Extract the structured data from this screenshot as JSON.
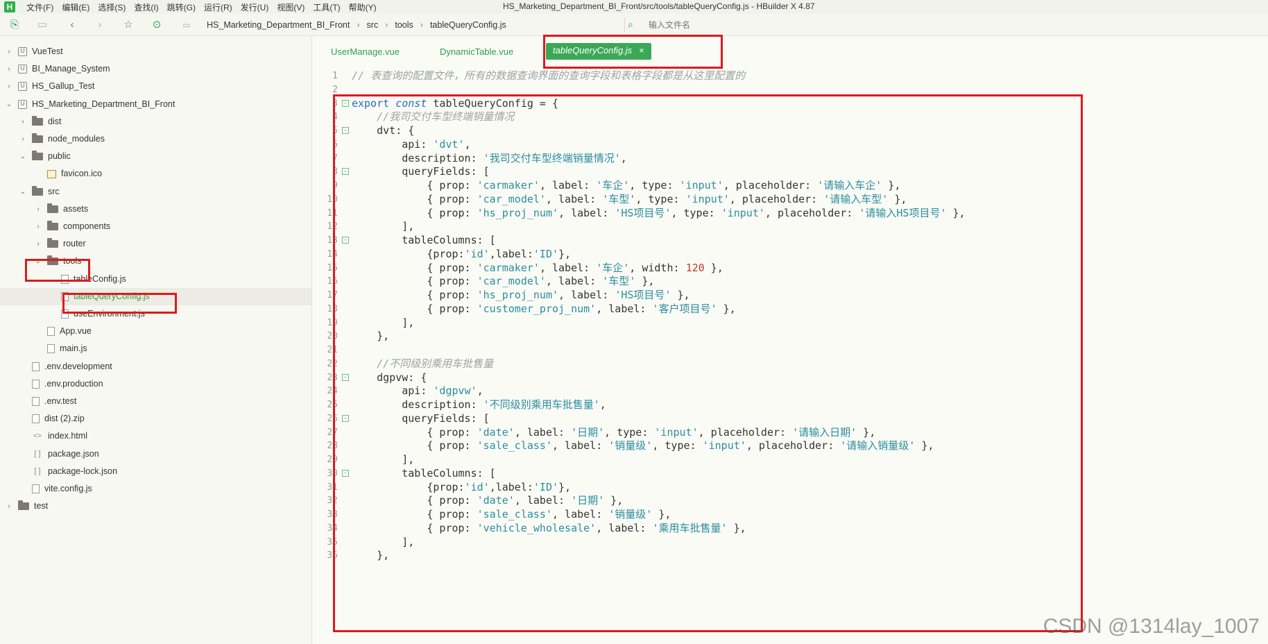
{
  "app": {
    "window_title": "HS_Marketing_Department_BI_Front/src/tools/tableQueryConfig.js - HBuilder X 4.87",
    "logo_letter": "H",
    "menus": [
      "文件(F)",
      "编辑(E)",
      "选择(S)",
      "查找(I)",
      "跳转(G)",
      "运行(R)",
      "发行(U)",
      "视图(V)",
      "工具(T)",
      "帮助(Y)"
    ]
  },
  "toolbar": {
    "breadcrumbs": [
      "HS_Marketing_Department_BI_Front",
      "src",
      "tools",
      "tableQueryConfig.js"
    ],
    "search_placeholder": "输入文件名"
  },
  "sidebar": {
    "items": [
      {
        "label": "VueTest",
        "depth": 0,
        "chev": "›",
        "icon": "project"
      },
      {
        "label": "BI_Manage_System",
        "depth": 0,
        "chev": "›",
        "icon": "project"
      },
      {
        "label": "HS_Gallup_Test",
        "depth": 0,
        "chev": "›",
        "icon": "project"
      },
      {
        "label": "HS_Marketing_Department_BI_Front",
        "depth": 0,
        "chev": "⌄",
        "icon": "project"
      },
      {
        "label": "dist",
        "depth": 1,
        "chev": "›",
        "icon": "folder"
      },
      {
        "label": "node_modules",
        "depth": 1,
        "chev": "›",
        "icon": "folder"
      },
      {
        "label": "public",
        "depth": 1,
        "chev": "⌄",
        "icon": "folder"
      },
      {
        "label": "favicon.ico",
        "depth": 2,
        "chev": "",
        "icon": "fileimg"
      },
      {
        "label": "src",
        "depth": 1,
        "chev": "⌄",
        "icon": "folder"
      },
      {
        "label": "assets",
        "depth": 2,
        "chev": "›",
        "icon": "folder"
      },
      {
        "label": "components",
        "depth": 2,
        "chev": "›",
        "icon": "folder"
      },
      {
        "label": "router",
        "depth": 2,
        "chev": "›",
        "icon": "folder"
      },
      {
        "label": "tools",
        "depth": 2,
        "chev": "⌄",
        "icon": "folder"
      },
      {
        "label": "tableConfig.js",
        "depth": 3,
        "chev": "",
        "icon": "file"
      },
      {
        "label": "tableQueryConfig.js",
        "depth": 3,
        "chev": "",
        "icon": "file",
        "selected": true
      },
      {
        "label": "useEnvironment.js",
        "depth": 3,
        "chev": "",
        "icon": "file"
      },
      {
        "label": "App.vue",
        "depth": 2,
        "chev": "",
        "icon": "file"
      },
      {
        "label": "main.js",
        "depth": 2,
        "chev": "",
        "icon": "file"
      },
      {
        "label": ".env.development",
        "depth": 1,
        "chev": "",
        "icon": "file"
      },
      {
        "label": ".env.production",
        "depth": 1,
        "chev": "",
        "icon": "file"
      },
      {
        "label": ".env.test",
        "depth": 1,
        "chev": "",
        "icon": "file"
      },
      {
        "label": "dist (2).zip",
        "depth": 1,
        "chev": "",
        "icon": "file"
      },
      {
        "label": "index.html",
        "depth": 1,
        "chev": "",
        "icon": "html"
      },
      {
        "label": "package.json",
        "depth": 1,
        "chev": "",
        "icon": "json"
      },
      {
        "label": "package-lock.json",
        "depth": 1,
        "chev": "",
        "icon": "json"
      },
      {
        "label": "vite.config.js",
        "depth": 1,
        "chev": "",
        "icon": "file"
      },
      {
        "label": "test",
        "depth": 0,
        "chev": "›",
        "icon": "folder"
      }
    ]
  },
  "tabs": [
    {
      "label": "UserManage.vue"
    },
    {
      "label": "DynamicTable.vue"
    },
    {
      "label": "tableQueryConfig.js",
      "active": true,
      "close": "×"
    }
  ],
  "code_lines": [
    {
      "n": "1",
      "fold": "",
      "t": [
        [
          "cm",
          "// 表查询的配置文件，所有的数据查询界面的查询字段和表格字段都是从这里配置的"
        ]
      ]
    },
    {
      "n": "2",
      "fold": "",
      "t": []
    },
    {
      "n": "3",
      "fold": "⊟",
      "t": [
        [
          "kw",
          "export "
        ],
        [
          "kwi",
          "const "
        ],
        [
          "pl",
          "tableQueryConfig = {"
        ]
      ]
    },
    {
      "n": "4",
      "fold": "",
      "t": [
        [
          "pl",
          "    "
        ],
        [
          "cm",
          "//我司交付车型终端销量情况"
        ]
      ]
    },
    {
      "n": "5",
      "fold": "⊟",
      "t": [
        [
          "pl",
          "    dvt: {"
        ]
      ]
    },
    {
      "n": "6",
      "fold": "",
      "t": [
        [
          "pl",
          "        api: "
        ],
        [
          "str",
          "'dvt'"
        ],
        [
          "pl",
          ","
        ]
      ]
    },
    {
      "n": "7",
      "fold": "",
      "t": [
        [
          "pl",
          "        description: "
        ],
        [
          "str",
          "'我司交付车型终端销量情况'"
        ],
        [
          "pl",
          ","
        ]
      ]
    },
    {
      "n": "8",
      "fold": "⊟",
      "t": [
        [
          "pl",
          "        queryFields: ["
        ]
      ]
    },
    {
      "n": "9",
      "fold": "",
      "t": [
        [
          "pl",
          "            { prop: "
        ],
        [
          "str",
          "'carmaker'"
        ],
        [
          "pl",
          ", label: "
        ],
        [
          "str",
          "'车企'"
        ],
        [
          "pl",
          ", type: "
        ],
        [
          "str",
          "'input'"
        ],
        [
          "pl",
          ", placeholder: "
        ],
        [
          "str",
          "'请输入车企'"
        ],
        [
          "pl",
          " },"
        ]
      ]
    },
    {
      "n": "10",
      "fold": "",
      "t": [
        [
          "pl",
          "            { prop: "
        ],
        [
          "str",
          "'car_model'"
        ],
        [
          "pl",
          ", label: "
        ],
        [
          "str",
          "'车型'"
        ],
        [
          "pl",
          ", type: "
        ],
        [
          "str",
          "'input'"
        ],
        [
          "pl",
          ", placeholder: "
        ],
        [
          "str",
          "'请输入车型'"
        ],
        [
          "pl",
          " },"
        ]
      ]
    },
    {
      "n": "11",
      "fold": "",
      "t": [
        [
          "pl",
          "            { prop: "
        ],
        [
          "str",
          "'hs_proj_num'"
        ],
        [
          "pl",
          ", label: "
        ],
        [
          "str",
          "'HS项目号'"
        ],
        [
          "pl",
          ", type: "
        ],
        [
          "str",
          "'input'"
        ],
        [
          "pl",
          ", placeholder: "
        ],
        [
          "str",
          "'请输入HS项目号'"
        ],
        [
          "pl",
          " },"
        ]
      ]
    },
    {
      "n": "12",
      "fold": "",
      "t": [
        [
          "pl",
          "        ],"
        ]
      ]
    },
    {
      "n": "13",
      "fold": "⊟",
      "t": [
        [
          "pl",
          "        tableColumns: ["
        ]
      ]
    },
    {
      "n": "14",
      "fold": "",
      "t": [
        [
          "pl",
          "            {prop:"
        ],
        [
          "str",
          "'id'"
        ],
        [
          "pl",
          ",label:"
        ],
        [
          "str",
          "'ID'"
        ],
        [
          "pl",
          "},"
        ]
      ]
    },
    {
      "n": "15",
      "fold": "",
      "t": [
        [
          "pl",
          "            { prop: "
        ],
        [
          "str",
          "'carmaker'"
        ],
        [
          "pl",
          ", label: "
        ],
        [
          "str",
          "'车企'"
        ],
        [
          "pl",
          ", width: "
        ],
        [
          "num",
          "120"
        ],
        [
          "pl",
          " },"
        ]
      ]
    },
    {
      "n": "16",
      "fold": "",
      "t": [
        [
          "pl",
          "            { prop: "
        ],
        [
          "str",
          "'car_model'"
        ],
        [
          "pl",
          ", label: "
        ],
        [
          "str",
          "'车型'"
        ],
        [
          "pl",
          " },"
        ]
      ]
    },
    {
      "n": "17",
      "fold": "",
      "t": [
        [
          "pl",
          "            { prop: "
        ],
        [
          "str",
          "'hs_proj_num'"
        ],
        [
          "pl",
          ", label: "
        ],
        [
          "str",
          "'HS项目号'"
        ],
        [
          "pl",
          " },"
        ]
      ]
    },
    {
      "n": "18",
      "fold": "",
      "t": [
        [
          "pl",
          "            { prop: "
        ],
        [
          "str",
          "'customer_proj_num'"
        ],
        [
          "pl",
          ", label: "
        ],
        [
          "str",
          "'客户项目号'"
        ],
        [
          "pl",
          " },"
        ]
      ]
    },
    {
      "n": "19",
      "fold": "",
      "t": [
        [
          "pl",
          "        ],"
        ]
      ]
    },
    {
      "n": "20",
      "fold": "",
      "t": [
        [
          "pl",
          "    },"
        ]
      ]
    },
    {
      "n": "21",
      "fold": "",
      "t": []
    },
    {
      "n": "22",
      "fold": "",
      "t": [
        [
          "pl",
          "    "
        ],
        [
          "cm",
          "//不同级别乘用车批售量"
        ]
      ]
    },
    {
      "n": "23",
      "fold": "⊟",
      "t": [
        [
          "pl",
          "    dgpvw: {"
        ]
      ]
    },
    {
      "n": "24",
      "fold": "",
      "t": [
        [
          "pl",
          "        api: "
        ],
        [
          "str",
          "'dgpvw'"
        ],
        [
          "pl",
          ","
        ]
      ]
    },
    {
      "n": "25",
      "fold": "",
      "t": [
        [
          "pl",
          "        description: "
        ],
        [
          "str",
          "'不同级别乘用车批售量'"
        ],
        [
          "pl",
          ","
        ]
      ]
    },
    {
      "n": "26",
      "fold": "⊟",
      "t": [
        [
          "pl",
          "        queryFields: ["
        ]
      ]
    },
    {
      "n": "27",
      "fold": "",
      "t": [
        [
          "pl",
          "            { prop: "
        ],
        [
          "str",
          "'date'"
        ],
        [
          "pl",
          ", label: "
        ],
        [
          "str",
          "'日期'"
        ],
        [
          "pl",
          ", type: "
        ],
        [
          "str",
          "'input'"
        ],
        [
          "pl",
          ", placeholder: "
        ],
        [
          "str",
          "'请输入日期'"
        ],
        [
          "pl",
          " },"
        ]
      ]
    },
    {
      "n": "28",
      "fold": "",
      "t": [
        [
          "pl",
          "            { prop: "
        ],
        [
          "str",
          "'sale_class'"
        ],
        [
          "pl",
          ", label: "
        ],
        [
          "str",
          "'销量级'"
        ],
        [
          "pl",
          ", type: "
        ],
        [
          "str",
          "'input'"
        ],
        [
          "pl",
          ", placeholder: "
        ],
        [
          "str",
          "'请输入销量级'"
        ],
        [
          "pl",
          " },"
        ]
      ]
    },
    {
      "n": "29",
      "fold": "",
      "t": [
        [
          "pl",
          "        ],"
        ]
      ]
    },
    {
      "n": "30",
      "fold": "⊟",
      "t": [
        [
          "pl",
          "        tableColumns: ["
        ]
      ]
    },
    {
      "n": "31",
      "fold": "",
      "t": [
        [
          "pl",
          "            {prop:"
        ],
        [
          "str",
          "'id'"
        ],
        [
          "pl",
          ",label:"
        ],
        [
          "str",
          "'ID'"
        ],
        [
          "pl",
          "},"
        ]
      ]
    },
    {
      "n": "32",
      "fold": "",
      "t": [
        [
          "pl",
          "            { prop: "
        ],
        [
          "str",
          "'date'"
        ],
        [
          "pl",
          ", label: "
        ],
        [
          "str",
          "'日期'"
        ],
        [
          "pl",
          " },"
        ]
      ]
    },
    {
      "n": "33",
      "fold": "",
      "t": [
        [
          "pl",
          "            { prop: "
        ],
        [
          "str",
          "'sale_class'"
        ],
        [
          "pl",
          ", label: "
        ],
        [
          "str",
          "'销量级'"
        ],
        [
          "pl",
          " },"
        ]
      ]
    },
    {
      "n": "34",
      "fold": "",
      "t": [
        [
          "pl",
          "            { prop: "
        ],
        [
          "str",
          "'vehicle_wholesale'"
        ],
        [
          "pl",
          ", label: "
        ],
        [
          "str",
          "'乘用车批售量'"
        ],
        [
          "pl",
          " },"
        ]
      ]
    },
    {
      "n": "35",
      "fold": "",
      "t": [
        [
          "pl",
          "        ],"
        ]
      ]
    },
    {
      "n": "36",
      "fold": "",
      "t": [
        [
          "pl",
          "    },"
        ]
      ]
    }
  ],
  "watermark": "CSDN @1314lay_1007",
  "colors": {
    "accent": "#2e9e4f",
    "highlight_box": "#e0191b",
    "tab_active_bg": "#3aa857"
  }
}
